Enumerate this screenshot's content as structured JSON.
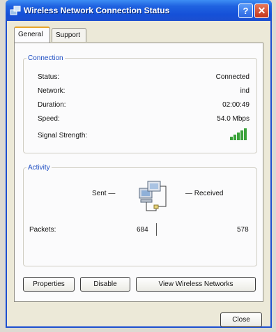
{
  "window": {
    "title": "Wireless Network Connection Status",
    "help_glyph": "?",
    "close_glyph": "✕"
  },
  "tabs": [
    {
      "label": "General"
    },
    {
      "label": "Support"
    }
  ],
  "connection": {
    "legend": "Connection",
    "status_label": "Status:",
    "status_value": "Connected",
    "network_label": "Network:",
    "network_value": "ind",
    "duration_label": "Duration:",
    "duration_value": "02:00:49",
    "speed_label": "Speed:",
    "speed_value": "54.0 Mbps",
    "signal_label": "Signal Strength:",
    "signal_bars": 5,
    "signal_color": "#3aa23a"
  },
  "activity": {
    "legend": "Activity",
    "sent_label": "Sent —",
    "received_label": "— Received",
    "packets_label": "Packets:",
    "sent_packets": "684",
    "received_packets": "578"
  },
  "buttons": {
    "properties": "Properties",
    "disable": "Disable",
    "view_networks": "View Wireless Networks",
    "close": "Close"
  },
  "colors": {
    "titlebar": "#1f62e0",
    "legend": "#1f4ec2",
    "tab_highlight": "#e8a52a"
  }
}
